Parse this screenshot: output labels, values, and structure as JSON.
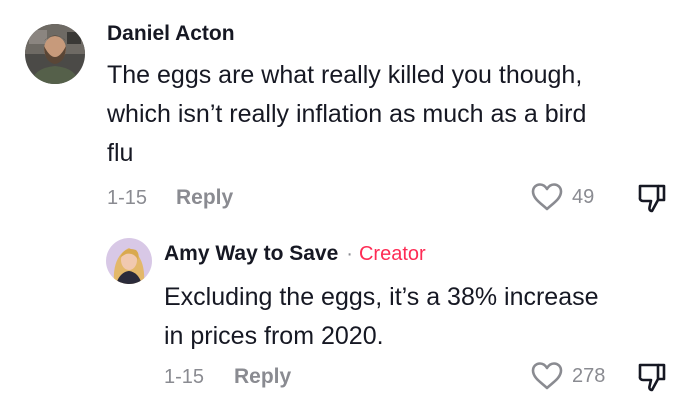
{
  "comments": [
    {
      "username": "Daniel Acton",
      "text_lines": [
        "The eggs are what really killed you though,",
        "which isn’t really inflation as much as a bird",
        "flu"
      ],
      "date": "1-15",
      "reply_label": "Reply",
      "likes": "49",
      "avatar_icon": "bearded-man-avatar"
    }
  ],
  "replies": [
    {
      "username": "Amy Way to Save",
      "separator": "·",
      "badge": "Creator",
      "text_lines": [
        "Excluding the eggs, it’s a 38% increase",
        "in prices from 2020."
      ],
      "date": "1-15",
      "reply_label": "Reply",
      "likes": "278",
      "avatar_icon": "blonde-woman-avatar"
    }
  ],
  "colors": {
    "text": "#161823",
    "muted": "#8a8b91",
    "creator_badge": "#fe2c55",
    "background": "#ffffff"
  },
  "icons": {
    "like": "heart-outline-icon",
    "dislike": "thumbs-down-outline-icon"
  }
}
